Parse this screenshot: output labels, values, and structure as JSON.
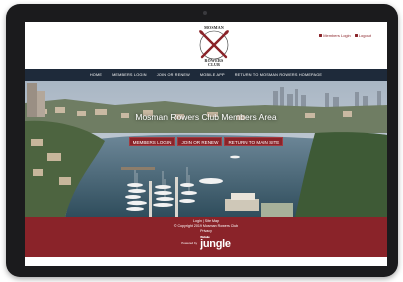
{
  "header": {
    "logo_top": "MOSMAN",
    "logo_bottom_1": "ROWERS",
    "logo_bottom_2": "CLUB",
    "member_links": [
      "Members Login",
      "Logout"
    ]
  },
  "nav": {
    "items": [
      "HOME",
      "MEMBERS LOGIN",
      "JOIN OR RENEW",
      "MOBILE APP",
      "RETURN TO MOSMAN ROWERS HOMEPAGE"
    ]
  },
  "hero": {
    "title": "Mosman Rowers Club Members Area",
    "buttons": [
      "MEMBERS LOGIN",
      "JOIN OR RENEW",
      "RETURN TO MAIN SITE"
    ]
  },
  "footer": {
    "links": "Login | Site Map",
    "copyright": "© Copyright 2019 Mosman Rowers Club",
    "privacy": "Privacy",
    "powered_by": "Powered by",
    "brand_small": "Website",
    "brand": "jungle"
  },
  "colors": {
    "accent": "#8a2329",
    "nav_bg": "#1e2a3a",
    "device": "#1b1b1d"
  }
}
